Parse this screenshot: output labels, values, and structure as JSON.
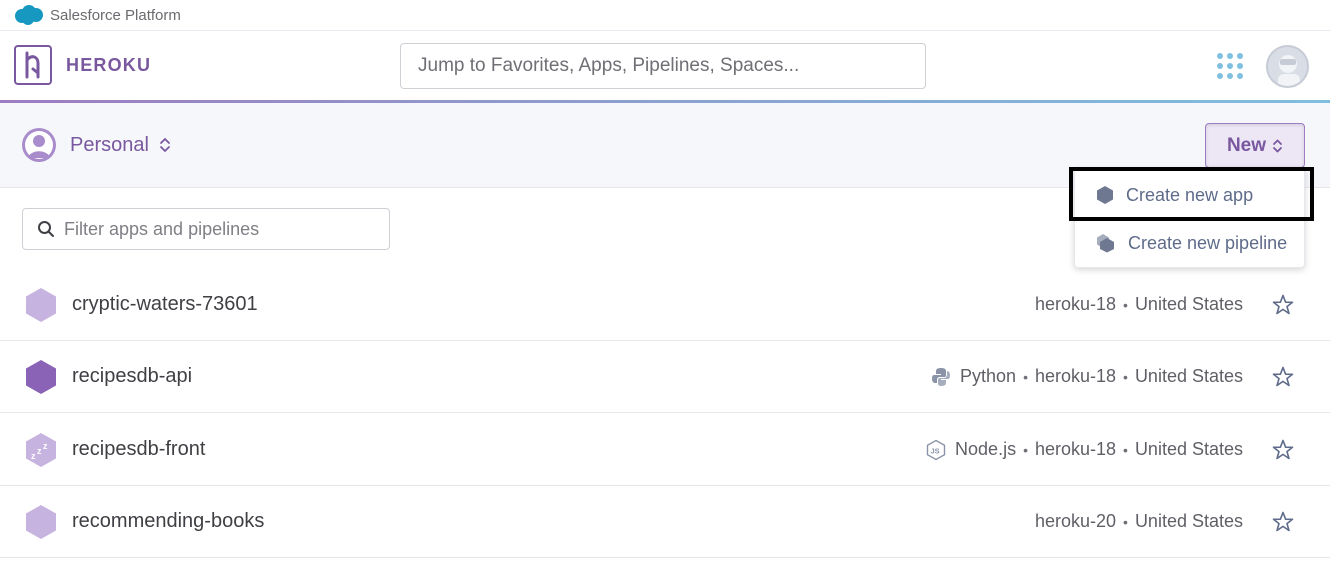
{
  "salesforce_bar": {
    "label": "Salesforce Platform"
  },
  "header": {
    "brand": "HEROKU",
    "search_placeholder": "Jump to Favorites, Apps, Pipelines, Spaces..."
  },
  "account": {
    "label": "Personal"
  },
  "new_button": {
    "label": "New"
  },
  "dropdown": {
    "create_app": "Create new app",
    "create_pipeline": "Create new pipeline"
  },
  "filter": {
    "placeholder": "Filter apps and pipelines"
  },
  "apps": [
    {
      "name": "cryptic-waters-73601",
      "language": "",
      "stack": "heroku-18",
      "region": "United States",
      "icon": "hexagon-light-icon"
    },
    {
      "name": "recipesdb-api",
      "language": "Python",
      "stack": "heroku-18",
      "region": "United States",
      "icon": "hexagon-dark-icon"
    },
    {
      "name": "recipesdb-front",
      "language": "Node.js",
      "stack": "heroku-18",
      "region": "United States",
      "icon": "sleeping-hexagon-icon"
    },
    {
      "name": "recommending-books",
      "language": "",
      "stack": "heroku-20",
      "region": "United States",
      "icon": "hexagon-light-icon"
    }
  ],
  "separator": "•",
  "colors": {
    "brand_purple": "#79589f",
    "hex_light": "#c7b3e0",
    "hex_dark": "#8a63b6",
    "accent_blue": "#7fc0e0"
  }
}
